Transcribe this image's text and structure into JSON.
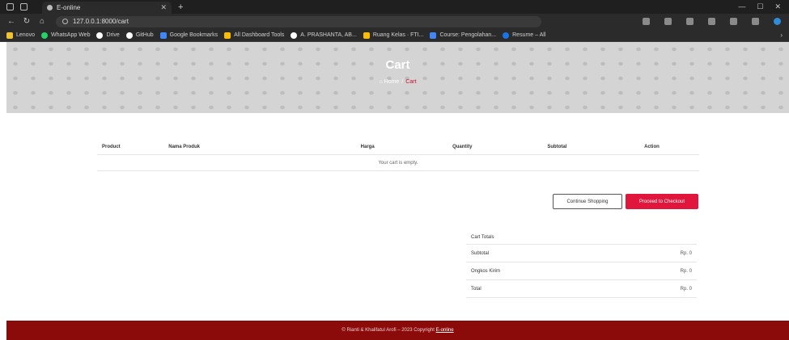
{
  "browser": {
    "tab_title": "E-online",
    "url": "127.0.0.1:8000/cart",
    "bookmarks": [
      {
        "label": "Lenovo",
        "icon": "folder-icon"
      },
      {
        "label": "WhatsApp Web",
        "icon": "whatsapp-icon"
      },
      {
        "label": "Drive",
        "icon": "drive-icon"
      },
      {
        "label": "GitHub",
        "icon": "github-icon"
      },
      {
        "label": "Google Bookmarks",
        "icon": "bookmark-icon"
      },
      {
        "label": "All Dashboard Tools",
        "icon": "grid-icon"
      },
      {
        "label": "A. PRASHANTA, AB...",
        "icon": "globe-icon"
      },
      {
        "label": "Ruang Kelas · FTI...",
        "icon": "class-icon"
      },
      {
        "label": "Course: Pengolahan...",
        "icon": "course-icon"
      },
      {
        "label": "Resume – All",
        "icon": "resume-icon"
      }
    ]
  },
  "hero": {
    "title": "Cart",
    "breadcrumb_home": "Home",
    "breadcrumb_separator": "/",
    "breadcrumb_current": "Cart"
  },
  "cart": {
    "columns": [
      "Product",
      "Nama Produk",
      "Harga",
      "Quantity",
      "Subtotal",
      "Action"
    ],
    "empty_message": "Your cart is empty."
  },
  "buttons": {
    "continue_shopping": "Continue Shopping",
    "proceed_checkout": "Proceed to Checkout"
  },
  "totals": {
    "title": "Cart Totals",
    "rows": [
      {
        "label": "Subtotal",
        "value": "Rp. 0"
      },
      {
        "label": "Ongkos Kirim",
        "value": "Rp. 0"
      },
      {
        "label": "Total",
        "value": "Rp. 0"
      }
    ]
  },
  "footer": {
    "text": "© Rianti & Khalifatul Arofi – 2023 Copyright",
    "brand": "E-online"
  },
  "colors": {
    "accent": "#e0163d",
    "footer": "#8b0a0a"
  }
}
